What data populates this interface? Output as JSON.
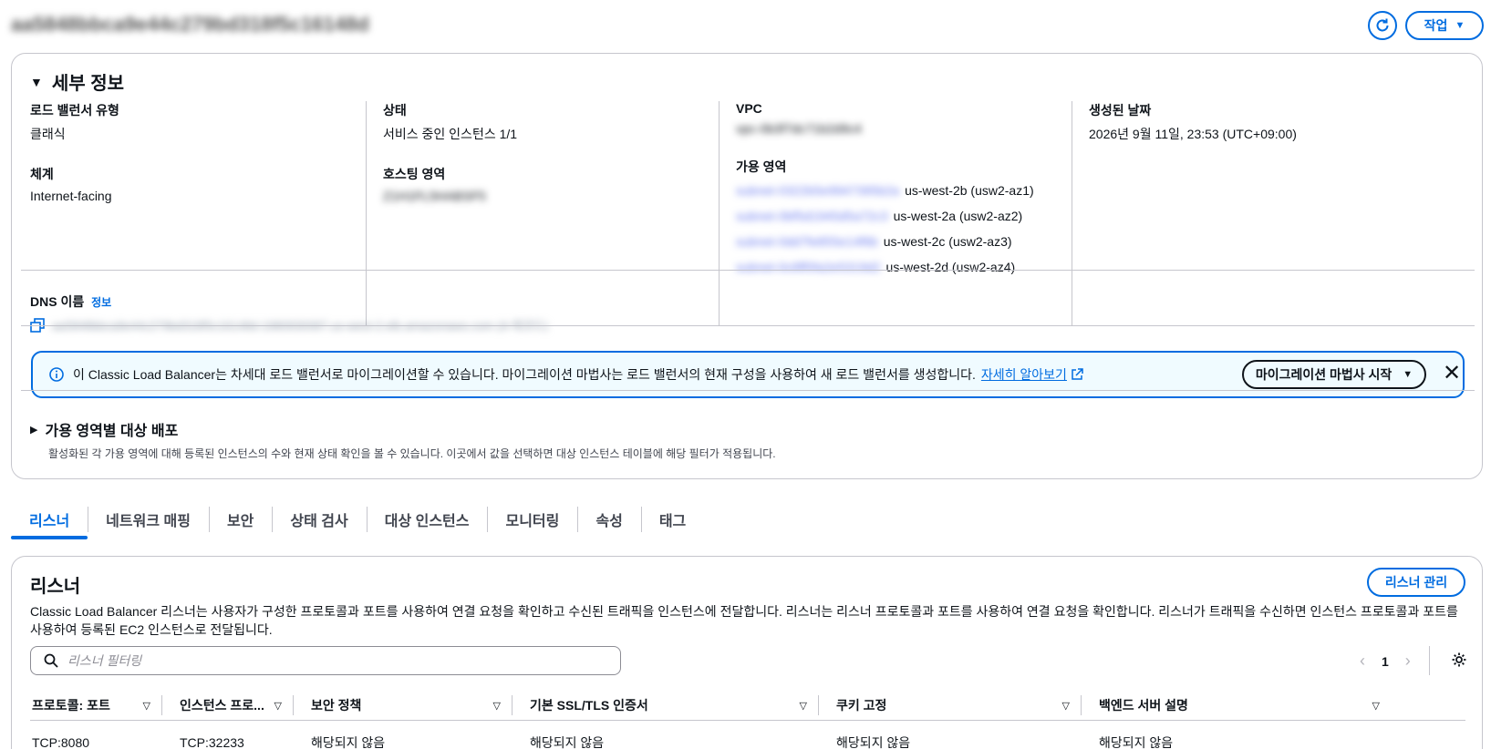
{
  "header": {
    "title": "aa5848bbca9e44c279bd318f5c16148d",
    "action_label": "작업"
  },
  "details": {
    "title": "세부 정보",
    "lb_type_label": "로드 밸런서 유형",
    "lb_type_value": "클래식",
    "scheme_label": "체계",
    "scheme_value": "Internet-facing",
    "status_label": "상태",
    "status_value": "서비스 중인 인스턴스 1/1",
    "hosted_zone_label": "호스팅 영역",
    "hosted_zone_value": "Z1H1FL5HABSF5",
    "vpc_label": "VPC",
    "vpc_value": "vpc-0b3f7dc71b2d9c4",
    "az_label": "가용 영역",
    "azs": [
      {
        "subnet": "subnet-0322b5e9947395b2a",
        "name": "us-west-2b (usw2-az1)"
      },
      {
        "subnet": "subnet-0bf5d1945d5a72c3",
        "name": "us-west-2a (usw2-az2)"
      },
      {
        "subnet": "subnet-0dd7fe855e14f6b",
        "name": "us-west-2c (usw2-az3)"
      },
      {
        "subnet": "subnet-0c6ff0fa2e5319d2",
        "name": "us-west-2d (usw2-az4)"
      }
    ],
    "created_label": "생성된 날짜",
    "created_value": "2026년 9월 11일, 23:53 (UTC+09:00)",
    "dns_label": "DNS 이름",
    "dns_info": "정보",
    "dns_value": "aa5848bbca9e44c279bd318f5c16148d-1980930087.us-west-2.elb.amazonaws.com (A 레코드)"
  },
  "alert": {
    "text": "이 Classic Load Balancer는 차세대 로드 밸런서로 마이그레이션할 수 있습니다. 마이그레이션 마법사는 로드 밸런서의 현재 구성을 사용하여 새 로드 밸런서를 생성합니다.",
    "link": "자세히 알아보기",
    "wizard_label": "마이그레이션 마법사 시작"
  },
  "distribution": {
    "title": "가용 영역별 대상 배포",
    "desc": "활성화된 각 가용 영역에 대해 등록된 인스턴스의 수와 현재 상태 확인을 볼 수 있습니다. 이곳에서 값을 선택하면 대상 인스턴스 테이블에 해당 필터가 적용됩니다."
  },
  "tabs": [
    "리스너",
    "네트워크 매핑",
    "보안",
    "상태 검사",
    "대상 인스턴스",
    "모니터링",
    "속성",
    "태그"
  ],
  "listeners": {
    "title": "리스너",
    "manage_label": "리스너 관리",
    "desc": "Classic Load Balancer 리스너는 사용자가 구성한 프로토콜과 포트를 사용하여 연결 요청을 확인하고 수신된 트래픽을 인스턴스에 전달합니다. 리스너는 리스너 프로토콜과 포트를 사용하여 연결 요청을 확인합니다. 리스너가 트래픽을 수신하면 인스턴스 프로토콜과 포트를 사용하여 등록된 EC2 인스턴스로 전달됩니다.",
    "search_placeholder": "리스너 필터링",
    "page": "1",
    "columns": [
      "프로토콜: 포트",
      "인스턴스 프로...",
      "보안 정책",
      "기본 SSL/TLS 인증서",
      "쿠키 고정",
      "백엔드 서버 설명"
    ],
    "rows": [
      [
        "TCP:8080",
        "TCP:32233",
        "해당되지 않음",
        "해당되지 않음",
        "해당되지 않음",
        "해당되지 않음"
      ]
    ]
  },
  "colors": {
    "accent": "#006ce0",
    "border": "#c6c6cd",
    "alert_bg": "#f0fbff"
  }
}
